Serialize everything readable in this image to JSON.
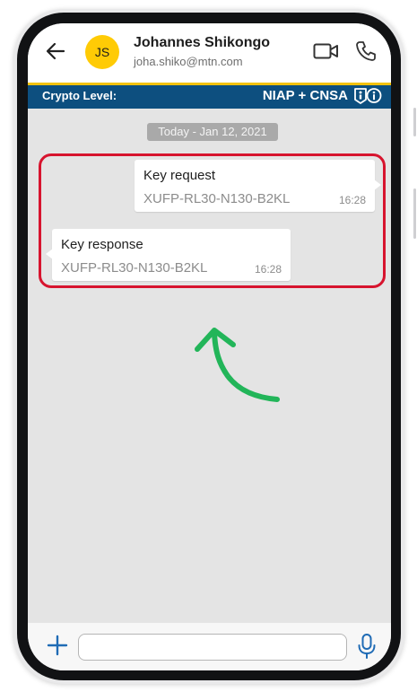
{
  "header": {
    "avatar_initials": "JS",
    "contact_name": "Johannes Shikongo",
    "contact_email": "joha.shiko@mtn.com",
    "icons": [
      "back-arrow-icon",
      "video-camera-icon",
      "phone-icon"
    ]
  },
  "crypto_bar": {
    "label": "Crypto Level:",
    "value": "NIAP + CNSA",
    "icon": "security-info-icon"
  },
  "chat": {
    "date_label": "Today - Jan 12, 2021",
    "messages": [
      {
        "direction": "outgoing",
        "title": "Key request",
        "code": "XUFP-RL30-N130-B2KL",
        "time": "16:28"
      },
      {
        "direction": "incoming",
        "title": "Key response",
        "code": "XUFP-RL30-N130-B2KL",
        "time": "16:28"
      }
    ]
  },
  "input_bar": {
    "value": "",
    "placeholder": "",
    "icons": [
      "plus-icon",
      "microphone-icon"
    ]
  },
  "colors": {
    "accent_yellow": "#ffcb05",
    "crypto_bar_blue": "#0d4f7f",
    "highlight_red": "#d7142e",
    "arrow_green": "#22b559",
    "primary_blue": "#1f6bb5"
  }
}
